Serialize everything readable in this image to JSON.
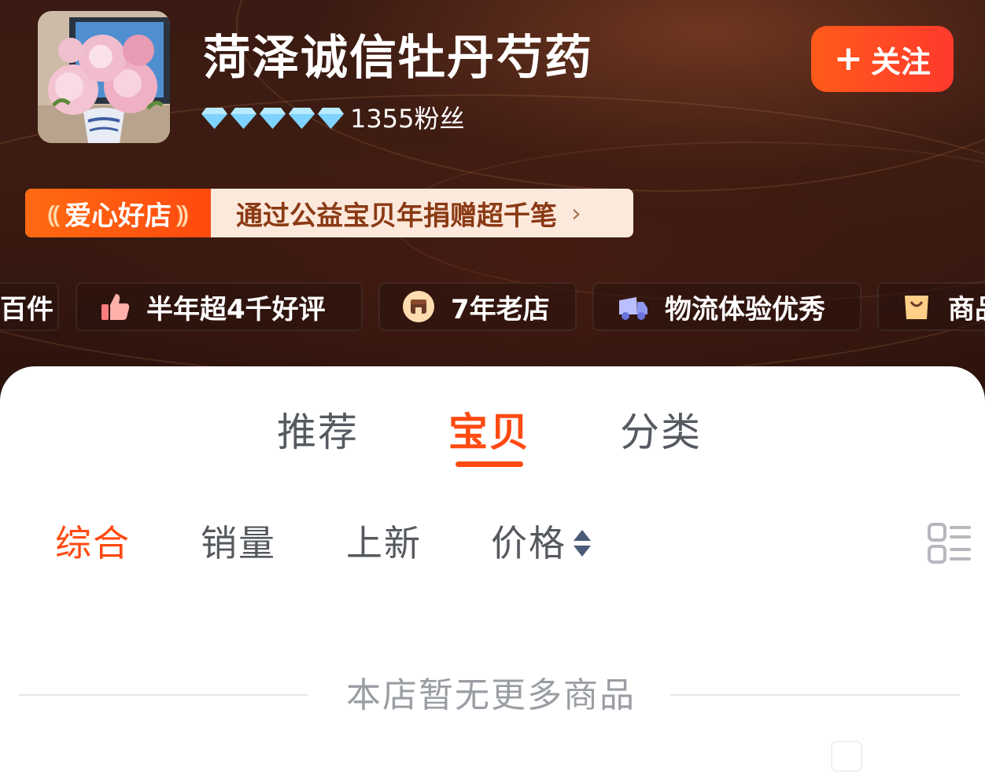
{
  "shop": {
    "name": "菏泽诚信牡丹芍药",
    "fans": "1355粉丝",
    "rating_diamonds": 5,
    "avatar_icon": "peony-bouquet-photo",
    "follow_label": "关注",
    "follow_icon": "plus-icon"
  },
  "charity": {
    "tag": "爱心好店",
    "text": "通过公益宝贝年捐赠超千笔",
    "chevron": "›"
  },
  "badges": [
    {
      "label": "百件",
      "icon": "none"
    },
    {
      "label": "半年超4千好评",
      "icon": "thumbs-up-icon"
    },
    {
      "label": "7年老店",
      "icon": "store-icon"
    },
    {
      "label": "物流体验优秀",
      "icon": "truck-icon"
    },
    {
      "label": "商品",
      "icon": "shopping-bag-icon"
    }
  ],
  "tabs": [
    {
      "label": "推荐",
      "active": false
    },
    {
      "label": "宝贝",
      "active": true
    },
    {
      "label": "分类",
      "active": false
    }
  ],
  "sort": [
    {
      "label": "综合",
      "active": true
    },
    {
      "label": "销量",
      "active": false
    },
    {
      "label": "上新",
      "active": false
    },
    {
      "label": "价格",
      "active": false
    }
  ],
  "empty_message": "本店暂无更多商品",
  "colors": {
    "accent": "#ff4a12",
    "hero_bg": "#3a1a12",
    "diamond": "#7fd4ff",
    "muted_text": "#9a9ea3"
  }
}
